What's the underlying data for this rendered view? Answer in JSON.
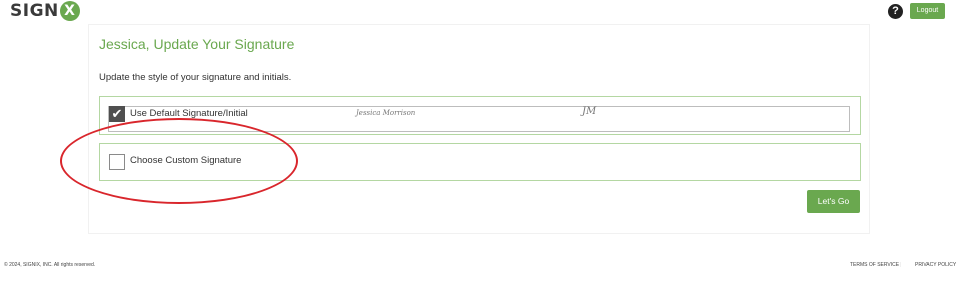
{
  "header": {
    "logo_text": "SIGN",
    "logo_mark": "X",
    "help_icon": "question-circle-icon",
    "help_label": "?",
    "logout_label": "Logout"
  },
  "main": {
    "title": "Jessica, Update Your Signature",
    "subtitle": "Update the style of your signature and initials.",
    "options": [
      {
        "label": "Use Default Signature/Initial",
        "checked": true,
        "checkmark": "✔",
        "signature_preview": "Jessica Morrison",
        "initials_preview": "JM"
      },
      {
        "label": "Choose Custom Signature",
        "checked": false
      }
    ],
    "submit_label": "Let's Go"
  },
  "annotation": {
    "color": "#d9262c"
  },
  "footer": {
    "copyright": "© 2024, SIGNIX, INC. All rights reserved.",
    "terms": "TERMS OF SERVICE",
    "privacy": "PRIVACY POLICY"
  },
  "colors": {
    "accent": "#6aa84f",
    "box_border": "#b4d7a2"
  }
}
